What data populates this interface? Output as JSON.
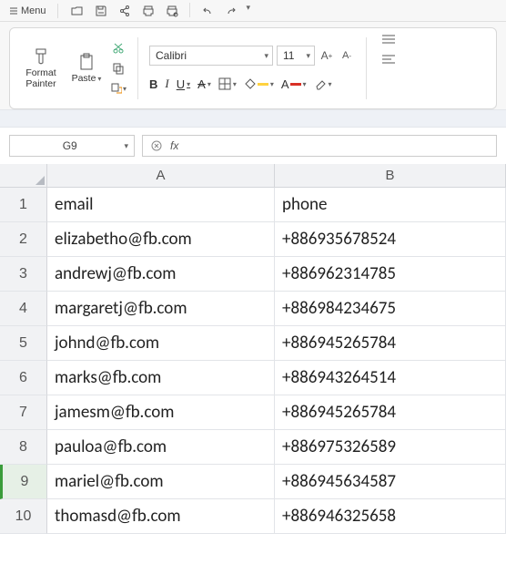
{
  "menubar": {
    "menu_label": "Menu"
  },
  "ribbon": {
    "format_painter_label": "Format\nPainter",
    "paste_label": "Paste",
    "font_name": "Calibri",
    "font_size": "11"
  },
  "namebox": {
    "value": "G9"
  },
  "sheet": {
    "columns": [
      "A",
      "B"
    ],
    "rows": [
      {
        "n": "1",
        "a": "email",
        "b": "phone"
      },
      {
        "n": "2",
        "a": "elizabetho@fb.com",
        "b": "+886935678524"
      },
      {
        "n": "3",
        "a": "andrewj@fb.com",
        "b": "+886962314785"
      },
      {
        "n": "4",
        "a": "margaretj@fb.com",
        "b": "+886984234675"
      },
      {
        "n": "5",
        "a": "johnd@fb.com",
        "b": "+886945265784"
      },
      {
        "n": "6",
        "a": "marks@fb.com",
        "b": "+886943264514"
      },
      {
        "n": "7",
        "a": "jamesm@fb.com",
        "b": "+886945265784"
      },
      {
        "n": "8",
        "a": "pauloa@fb.com",
        "b": "+886975326589"
      },
      {
        "n": "9",
        "a": "mariel@fb.com",
        "b": "+886945634587"
      },
      {
        "n": "10",
        "a": "thomasd@fb.com",
        "b": "+886946325658"
      }
    ],
    "selected_row": "9"
  }
}
